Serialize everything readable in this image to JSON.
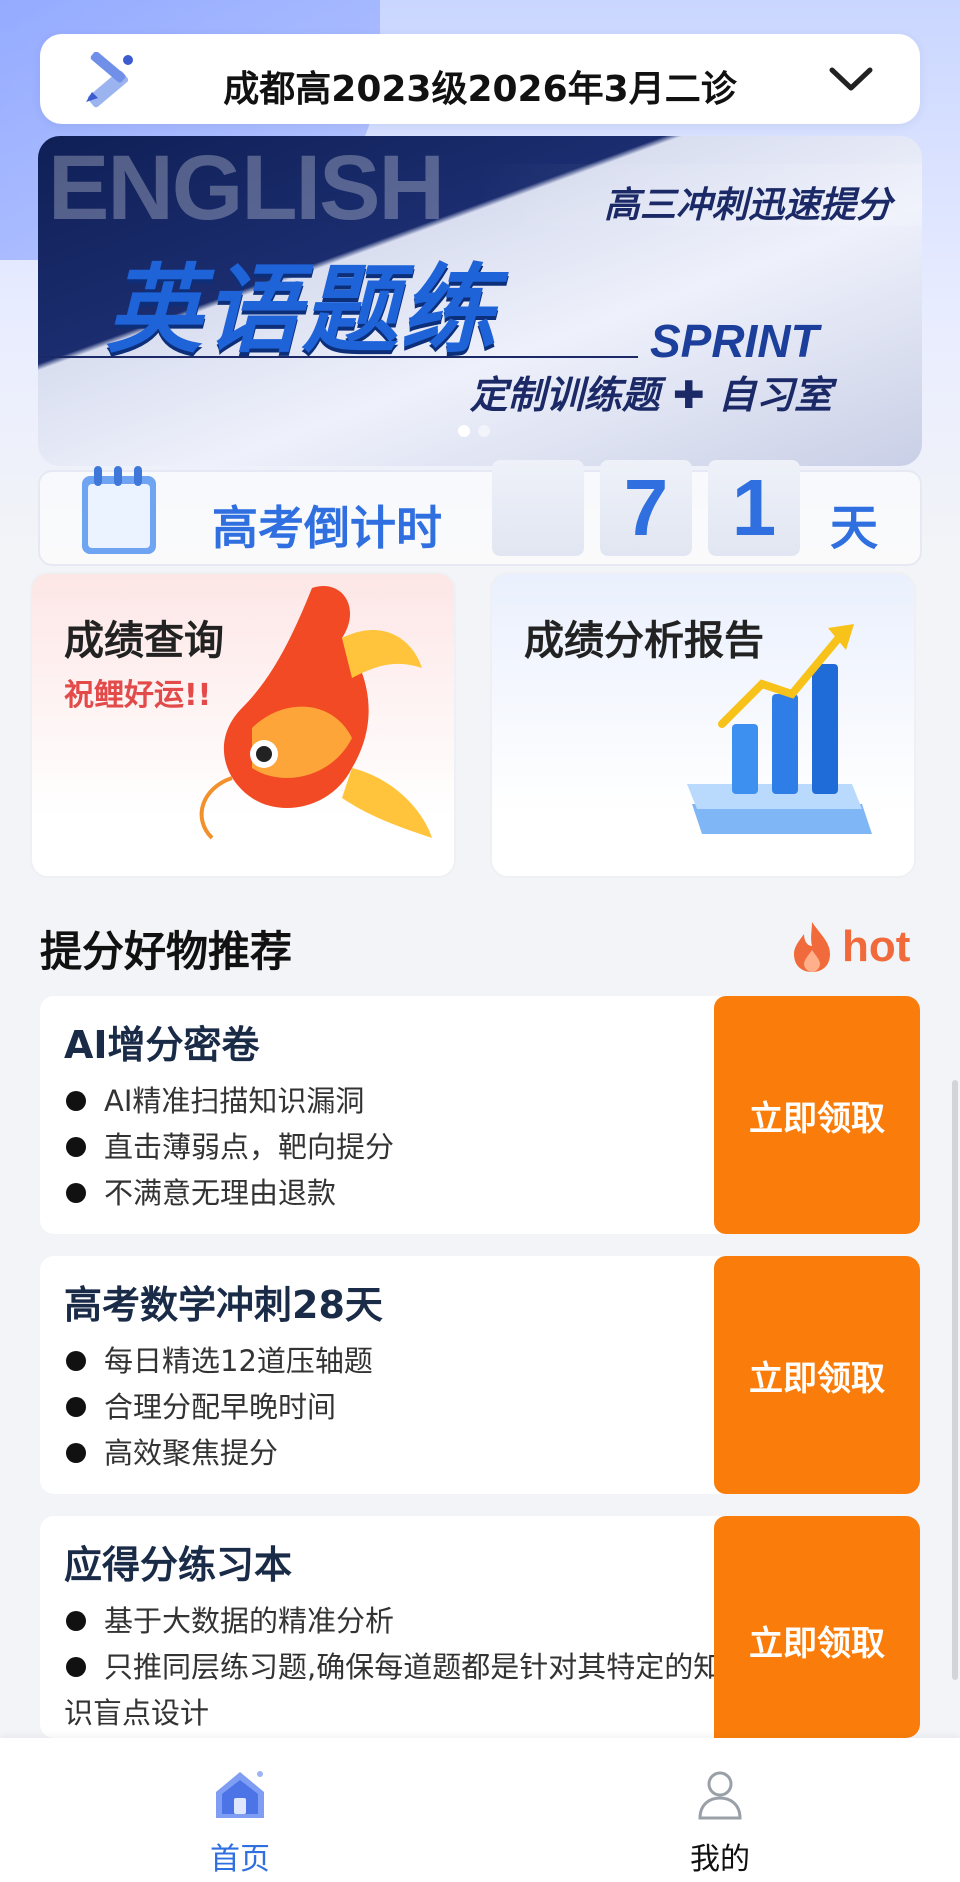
{
  "exam_selector": {
    "title": "成都高2023级2026年3月二诊",
    "icon": "pencil-ruler-icon",
    "dropdown_icon": "chevron-down-icon"
  },
  "banner": {
    "bg_word": "ENGLISH",
    "slogan": "高三冲刺迅速提分",
    "main_title": "英语题练",
    "sprint": "SPRINT",
    "subline": "定制训练题 ✚ 自习室",
    "page_count": 2,
    "active_page": 1
  },
  "countdown": {
    "label": "高考倒计时",
    "digits": [
      "",
      "7",
      "1"
    ],
    "unit": "天"
  },
  "cards": {
    "score": {
      "title": "成绩查询",
      "subtitle": "祝鲤好运!!"
    },
    "report": {
      "title": "成绩分析报告"
    }
  },
  "section": {
    "title": "提分好物推荐",
    "hot_label": "hot"
  },
  "products": [
    {
      "name": "AI增分密卷",
      "bullets": [
        "AI精准扫描知识漏洞",
        "直击薄弱点，靶向提分",
        "不满意无理由退款"
      ],
      "cta": "立即领取"
    },
    {
      "name": "高考数学冲刺28天",
      "bullets": [
        "每日精选12道压轴题",
        "合理分配早晚时间",
        "高效聚焦提分"
      ],
      "cta": "立即领取"
    },
    {
      "name": "应得分练习本",
      "bullets": [
        "基于大数据的精准分析",
        "只推同层练习题,确保每道题都是针对其特定的知识盲点设计"
      ],
      "cta": "立即领取"
    }
  ],
  "tabbar": {
    "home": "首页",
    "me": "我的"
  },
  "colors": {
    "accent": "#2f6fe0",
    "cta": "#fa7d0b",
    "hot": "#f06a3c"
  }
}
